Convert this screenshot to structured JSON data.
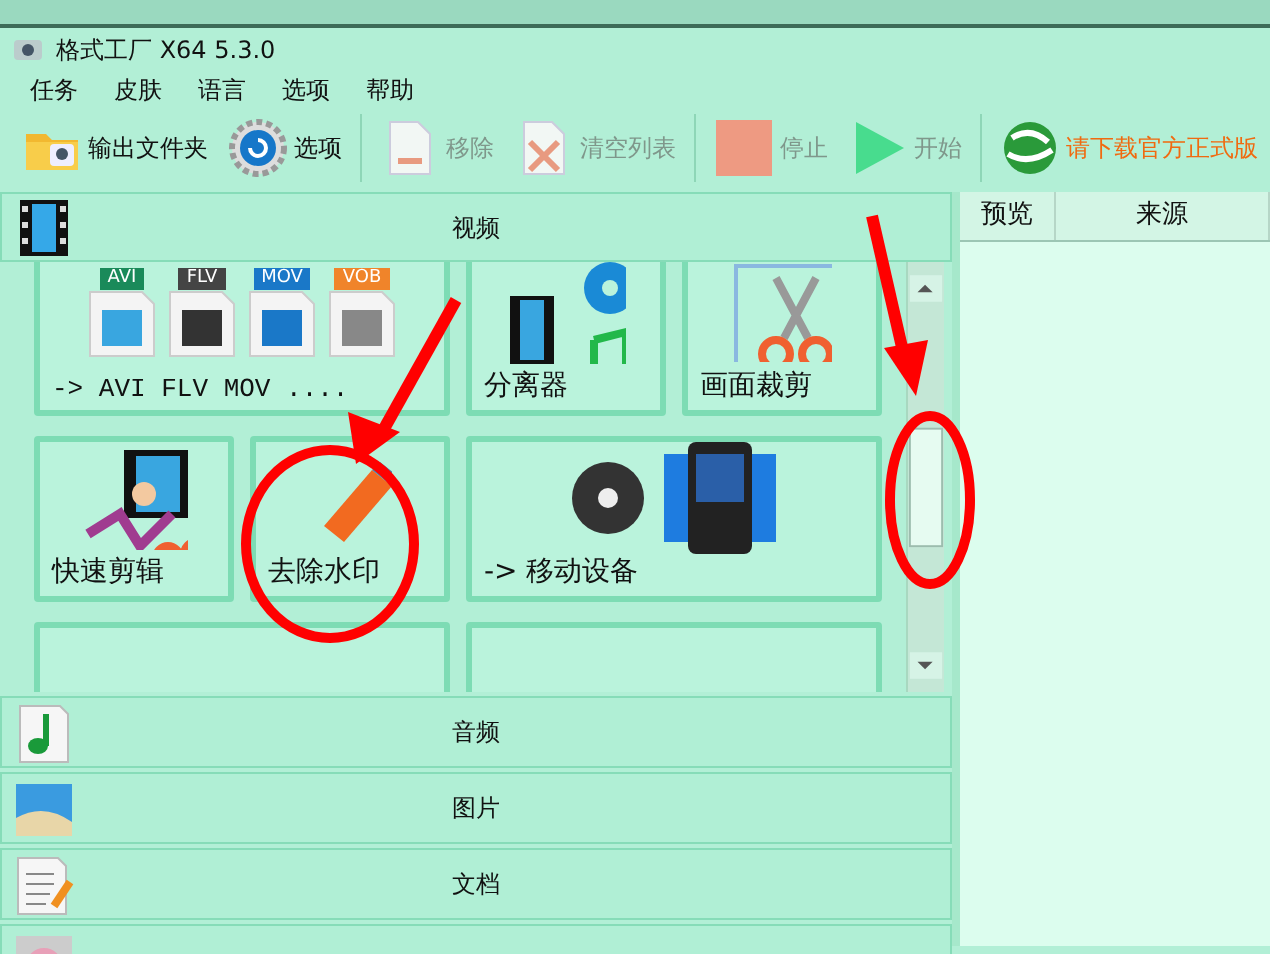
{
  "window": {
    "title": "格式工厂 X64 5.3.0"
  },
  "menu": [
    "任务",
    "皮肤",
    "语言",
    "选项",
    "帮助"
  ],
  "toolbar": [
    [
      {
        "kind": "folder",
        "label": "输出文件夹",
        "disabled": false
      },
      {
        "kind": "gear",
        "label": "选项",
        "disabled": false
      }
    ],
    [
      {
        "kind": "remove",
        "label": "移除",
        "disabled": true
      },
      {
        "kind": "clear",
        "label": "清空列表",
        "disabled": true
      }
    ],
    [
      {
        "kind": "stop",
        "label": "停止",
        "disabled": true
      },
      {
        "kind": "play",
        "label": "开始",
        "disabled": true
      }
    ],
    [
      {
        "kind": "globe",
        "label": "请下载官方正式版",
        "disabled": false
      }
    ]
  ],
  "video_section": {
    "title": "视频",
    "tiles": [
      {
        "kind": "formats",
        "label": "-> AVI FLV MOV ....",
        "tags": [
          "AVI",
          "FLV",
          "MOV",
          "VOB"
        ],
        "wide": true
      },
      {
        "kind": "splitter",
        "label": "分离器",
        "wide": false
      },
      {
        "kind": "crop",
        "label": "画面裁剪",
        "wide": false
      },
      {
        "kind": "quickcut",
        "label": "快速剪辑",
        "wide": false
      },
      {
        "kind": "eraser",
        "label": "去除水印",
        "wide": false
      },
      {
        "kind": "mobile",
        "label": "-> 移动设备",
        "wide": true
      },
      {
        "kind": "partial",
        "wide": true
      },
      {
        "kind": "partial",
        "wide": true
      }
    ]
  },
  "categories": [
    {
      "kind": "audio",
      "label": "音频"
    },
    {
      "kind": "picture",
      "label": "图片"
    },
    {
      "kind": "document",
      "label": "文档"
    },
    {
      "kind": "disc"
    }
  ],
  "task_list": {
    "columns": [
      "预览",
      "来源"
    ]
  }
}
